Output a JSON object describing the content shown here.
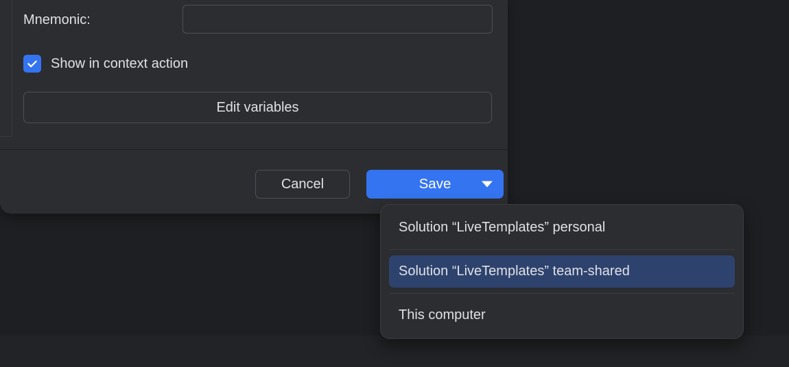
{
  "form": {
    "mnemonic_label": "Mnemonic:",
    "mnemonic_value": "",
    "show_in_context_label": "Show in context action",
    "show_in_context_checked": true,
    "edit_variables_label": "Edit variables"
  },
  "buttons": {
    "cancel": "Cancel",
    "save": "Save"
  },
  "save_menu": {
    "items": [
      "Solution “LiveTemplates” personal",
      "Solution “LiveTemplates” team-shared",
      "This computer"
    ],
    "selected_index": 1
  },
  "colors": {
    "accent": "#3574f0",
    "panel": "#2b2d30",
    "background": "#1e1f22",
    "selection": "#2e426e"
  }
}
